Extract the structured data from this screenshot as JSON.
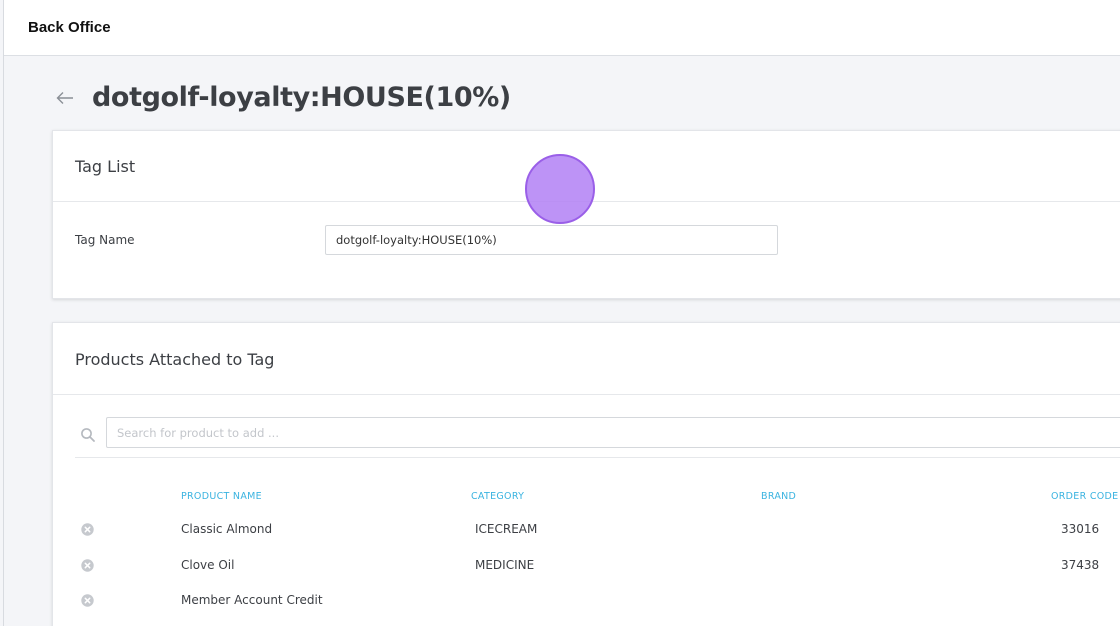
{
  "app": {
    "brand": "Back Office"
  },
  "page": {
    "title": "dotgolf-loyalty:HOUSE(10%)"
  },
  "tag_list": {
    "title": "Tag List",
    "tag_name_label": "Tag Name",
    "tag_name_value": "dotgolf-loyalty:HOUSE(10%)"
  },
  "products": {
    "title": "Products Attached to Tag",
    "search_placeholder": "Search for product to add ...",
    "columns": {
      "product_name": "PRODUCT NAME",
      "category": "CATEGORY",
      "brand": "BRAND",
      "order_code": "ORDER CODE"
    },
    "rows": [
      {
        "name": "Classic Almond",
        "category": "ICECREAM",
        "brand": "",
        "order_code": "33016"
      },
      {
        "name": "Clove Oil",
        "category": "MEDICINE",
        "brand": "",
        "order_code": "37438"
      },
      {
        "name": "Member Account Credit",
        "category": "",
        "brand": "",
        "order_code": ""
      }
    ]
  },
  "icons": {
    "back": "arrow-left-icon",
    "search": "search-icon",
    "remove": "remove-circle-icon"
  },
  "colors": {
    "accent": "#3ab3e0",
    "cursor_fill": "#b280f5",
    "background": "#f4f5f8"
  }
}
